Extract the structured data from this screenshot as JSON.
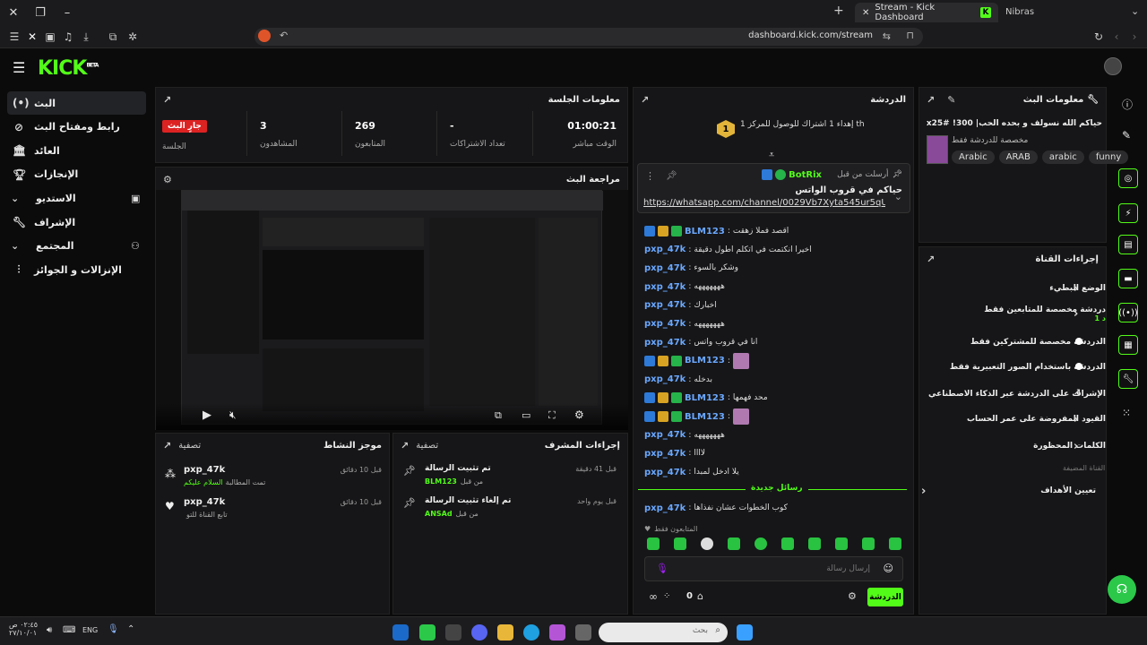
{
  "browser": {
    "tabs": [
      {
        "label": "Stream - Kick Dashboard"
      },
      {
        "label": "Nibras"
      }
    ],
    "url": "dashboard.kick.com/stream"
  },
  "sidebar": {
    "items": [
      {
        "label": "البث",
        "icon": "live-icon"
      },
      {
        "label": "رابط ومفتاح البث",
        "icon": "link-icon"
      },
      {
        "label": "العائد",
        "icon": "bank-icon"
      },
      {
        "label": "الإنجازات",
        "icon": "trophy-icon"
      },
      {
        "label": "الاستديو",
        "icon": "studio-icon"
      },
      {
        "label": "الإشراف",
        "icon": "wrench-icon"
      },
      {
        "label": "المجتمع",
        "icon": "community-icon"
      },
      {
        "label": "الإنزالات و الجوائز",
        "icon": "drops-icon"
      }
    ]
  },
  "session": {
    "title": "معلومات الجلسة",
    "live_badge": "جارٍ البث",
    "live_label": "الجلسة",
    "stats": [
      {
        "value": "01:00:21",
        "label": "الوقت مباشر"
      },
      {
        "value": "-",
        "label": "تعداد الاشتراكات"
      },
      {
        "value": "269",
        "label": "المتابعون"
      },
      {
        "value": "3",
        "label": "المشاهدون"
      }
    ]
  },
  "preview": {
    "title": "مراجعة البث"
  },
  "activity": {
    "title": "موجز النشاط",
    "filter": "تصفية",
    "items": [
      {
        "user": "pxp_47k",
        "time": "قبل 10 دقائق",
        "text": "تمت المطالبة",
        "highlight": "السلام عليكم"
      },
      {
        "user": "pxp_47k",
        "time": "قبل 10 دقائق",
        "text": "تابع القناة للتو",
        "highlight": ""
      }
    ]
  },
  "modactions": {
    "title": "إجراءات المشرف",
    "filter": "تصفية",
    "items": [
      {
        "action": "تم تثبيت الرسالة",
        "time": "قبل 41 دقيقة",
        "by_label": "من قبل",
        "by": "BLM123"
      },
      {
        "action": "تم إلغاء تثبيت الرسالة",
        "time": "قبل يوم واحد",
        "by_label": "من قبل",
        "by": "ANSAd"
      }
    ]
  },
  "chat": {
    "title": "الدردشة",
    "goal_rank": "1",
    "goal_text": "إهداء 1 اشتراك للوصول للمركز 1 th",
    "pinned_by": "أرسلت من قبل",
    "pinned_user": "BotRix",
    "pinned_text": "حياكم في قروب الواتس",
    "pinned_link": "https://whatsapp.com/channel/0029Vb7Xyta545ur5qUz...",
    "messages": [
      {
        "user": "BLM123",
        "badges": "bgg",
        "text": "اقصد فملا زهقت"
      },
      {
        "user": "pxp_47k",
        "badges": "",
        "text": "اخيرا انكتمت في اتكلم اطول دقيقة"
      },
      {
        "user": "pxp_47k",
        "badges": "",
        "text": "وشكر بالسوء"
      },
      {
        "user": "pxp_47k",
        "badges": "",
        "text": "هههههههه"
      },
      {
        "user": "pxp_47k",
        "badges": "",
        "text": "اخبارك"
      },
      {
        "user": "pxp_47k",
        "badges": "",
        "text": "هههههههه"
      },
      {
        "user": "pxp_47k",
        "badges": "",
        "text": "انا في قروب واتس"
      },
      {
        "user": "BLM123",
        "badges": "bggp",
        "text": ""
      },
      {
        "user": "pxp_47k",
        "badges": "",
        "text": "بدخله"
      },
      {
        "user": "BLM123",
        "badges": "bgg",
        "text": "محد فهمها"
      },
      {
        "user": "BLM123",
        "badges": "bggp",
        "text": ""
      },
      {
        "user": "pxp_47k",
        "badges": "",
        "text": "هههههههه"
      },
      {
        "user": "pxp_47k",
        "badges": "",
        "text": "لاااا"
      },
      {
        "user": "pxp_47k",
        "badges": "",
        "text": "يلا ادخل لمبدا"
      }
    ],
    "new_messages": "رسائل جديدة",
    "last_message": {
      "user": "pxp_47k",
      "text": "كوب الخطوات عشان نفذاها"
    },
    "followers_only": "المتابعون فقط",
    "input_placeholder": "إرسال رسالة",
    "send_label": "الدردشة",
    "count": "0"
  },
  "stream_info": {
    "title": "معلومات البث",
    "stream_title": "حياكم الله نسولف و بحده الحب| 300! zeyadx25#",
    "category": "مخصصة للدردشة فقط",
    "tags": [
      "Arabic",
      "ARAB",
      "arabic",
      "funny"
    ]
  },
  "channel_actions": {
    "title": "إجراءات القناة",
    "rows": [
      {
        "label": "الوضع البطيء",
        "control": "chevron"
      },
      {
        "label": "دردشة مخصصة للمتابعين فقط",
        "sub": "1 د",
        "control": "chevron"
      },
      {
        "label": "الدردشة مخصصة للمشتركين فقط",
        "control": "toggle"
      },
      {
        "label": "الدردشة باستخدام الصور التعبيرية فقط",
        "control": "toggle"
      },
      {
        "label": "الإشراف على الدردشة عبر الذكاء الاصطناعي",
        "control": "ext"
      },
      {
        "label": "القيود المفروضة على عمر الحساب",
        "control": "chevron"
      },
      {
        "label": "الكلمات المحظورة",
        "control": "chevron"
      }
    ],
    "section": "القناة المضيفة",
    "host_row": "تعيين الأهداف"
  },
  "taskbar": {
    "time": "٠٢:٤٥ ص",
    "date": "٢٧/١٠/٠١",
    "lang": "ENG",
    "search_placeholder": "بحث"
  }
}
